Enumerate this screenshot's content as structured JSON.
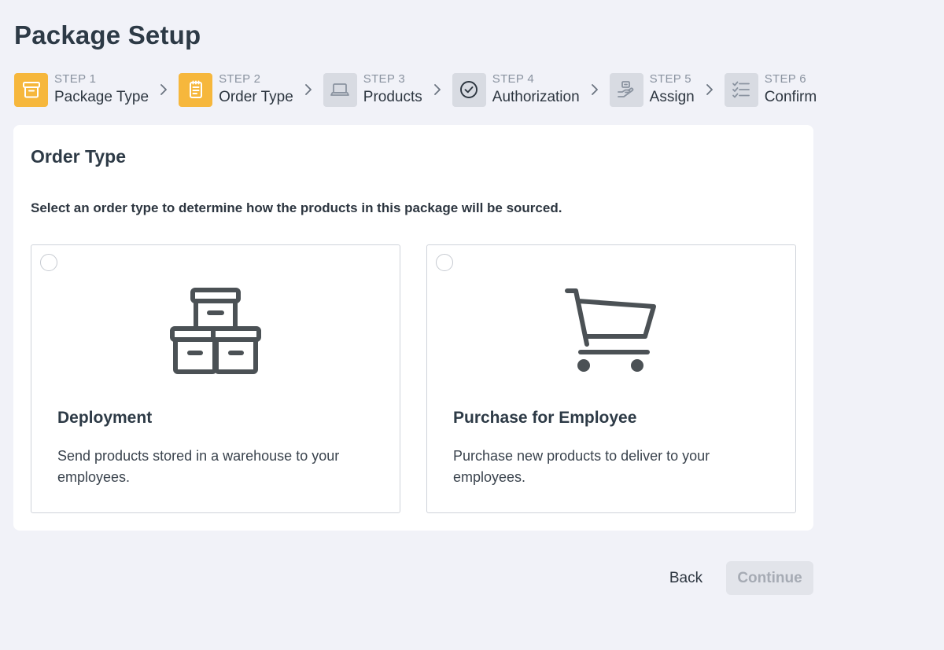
{
  "page": {
    "title": "Package Setup"
  },
  "stepper": {
    "steps": [
      {
        "num": "STEP 1",
        "label": "Package Type",
        "icon": "archive-box-icon",
        "state": "active"
      },
      {
        "num": "STEP 2",
        "label": "Order Type",
        "icon": "clipboard-list-icon",
        "state": "active"
      },
      {
        "num": "STEP 3",
        "label": "Products",
        "icon": "laptop-icon",
        "state": "inactive"
      },
      {
        "num": "STEP 4",
        "label": "Authorization",
        "icon": "check-circle-icon",
        "state": "inactive"
      },
      {
        "num": "STEP 5",
        "label": "Assign",
        "icon": "hand-package-icon",
        "state": "inactive"
      },
      {
        "num": "STEP 6",
        "label": "Confirm",
        "icon": "checklist-icon",
        "state": "inactive"
      }
    ]
  },
  "order_type": {
    "title": "Order Type",
    "instruction": "Select an order type to determine how the products in this package will be sourced.",
    "options": [
      {
        "title": "Deployment",
        "description": "Send products stored in a warehouse to your employees.",
        "icon": "stacked-boxes-icon",
        "selected": false
      },
      {
        "title": "Purchase for Employee",
        "description": "Purchase new products to deliver to your employees.",
        "icon": "shopping-cart-icon",
        "selected": false
      }
    ]
  },
  "footer": {
    "back_label": "Back",
    "continue_label": "Continue"
  },
  "colors": {
    "accent": "#f6b73c",
    "inactive_step": "#d8dbe2",
    "background": "#f1f2f8",
    "disabled_button": "#e2e4ea"
  }
}
